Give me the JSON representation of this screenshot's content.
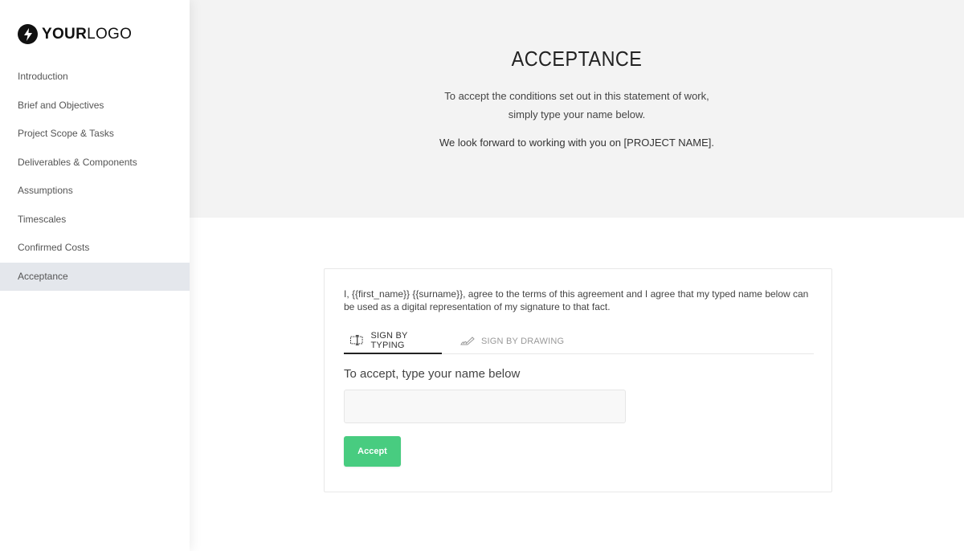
{
  "logo": {
    "bold": "YOUR",
    "light": "LOGO",
    "icon": "lightning-bolt-icon"
  },
  "sidebar": {
    "items": [
      {
        "label": "Introduction",
        "active": false
      },
      {
        "label": "Brief and Objectives",
        "active": false
      },
      {
        "label": "Project Scope & Tasks",
        "active": false
      },
      {
        "label": "Deliverables & Components",
        "active": false
      },
      {
        "label": "Assumptions",
        "active": false
      },
      {
        "label": "Timescales",
        "active": false
      },
      {
        "label": "Confirmed Costs",
        "active": false
      },
      {
        "label": "Acceptance",
        "active": true
      }
    ]
  },
  "hero": {
    "title": "ACCEPTANCE",
    "line1": "To accept the conditions set out in this statement of work,",
    "line2": "simply type your name below.",
    "line3": "We look forward to working with you on [PROJECT NAME]."
  },
  "signature": {
    "agreement_text": "I, {{first_name}} {{surname}}, agree to the terms of this agreement and I agree that my typed name below can be used as a digital representation of my signature to that fact.",
    "tabs": [
      {
        "label": "SIGN BY TYPING",
        "icon": "text-cursor-icon",
        "active": true
      },
      {
        "label": "SIGN BY DRAWING",
        "icon": "pen-signature-icon",
        "active": false
      }
    ],
    "input_label": "To accept, type your name below",
    "input_value": "",
    "input_placeholder": "",
    "accept_label": "Accept"
  },
  "colors": {
    "accent_green": "#48cc80",
    "active_nav_bg": "#e4e7ec",
    "hero_bg": "#f3f3f3"
  }
}
